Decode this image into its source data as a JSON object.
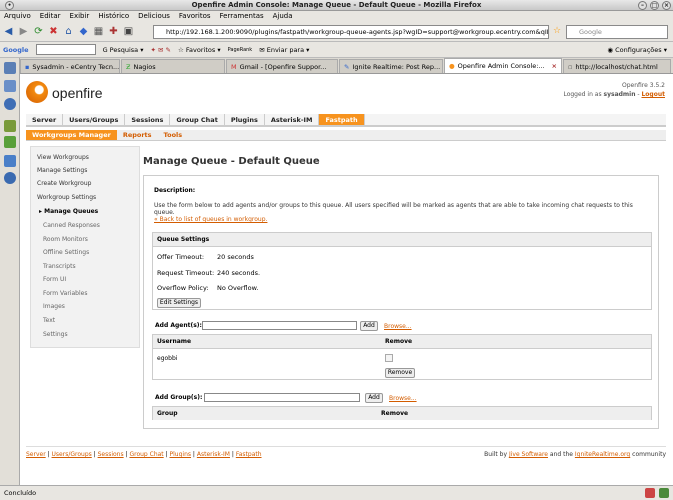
{
  "window": {
    "title": "Openfire Admin Console: Manage Queue - Default Queue - Mozilla Firefox"
  },
  "menu": [
    "Arquivo",
    "Editar",
    "Exibir",
    "Histórico",
    "Delicious",
    "Favoritos",
    "Ferramentas",
    "Ajuda"
  ],
  "address": {
    "url": "http://192.168.1.200:9090/plugins/fastpath/workgroup-queue-agents.jsp?wgID=support@workgroup.ecentry.com&qID"
  },
  "search": {
    "placeholder": "Google"
  },
  "googlebar": {
    "label": "Google",
    "pesquisa": "Pesquisa",
    "favoritos": "Favoritos",
    "pagerank": "PageRank",
    "enviar": "Enviar para",
    "config": "Configurações"
  },
  "tabs": [
    {
      "label": "Sysadmin - eCentry Tecn...",
      "active": false
    },
    {
      "label": "Nagios",
      "active": false
    },
    {
      "label": "Gmail - [Openfire Suppor...",
      "active": false
    },
    {
      "label": "Ignite Realtime: Post Rep...",
      "active": false
    },
    {
      "label": "Openfire Admin Console:...",
      "active": true
    },
    {
      "label": "http://localhost/chat.html",
      "active": false
    }
  ],
  "app": {
    "logo": "openfire",
    "version": "Openfire 3.5.2",
    "logged_prefix": "Logged in as",
    "user": "sysadmin",
    "logout": "Logout"
  },
  "mainnav": [
    "Server",
    "Users/Groups",
    "Sessions",
    "Group Chat",
    "Plugins",
    "Asterisk-IM",
    "Fastpath"
  ],
  "subnav": [
    "Workgroups Manager",
    "Reports",
    "Tools"
  ],
  "sidebar": {
    "items": [
      "View Workgroups",
      "Manage Settings",
      "Create Workgroup",
      "Workgroup Settings"
    ],
    "current": "Manage Queues",
    "subitems": [
      "Canned Responses",
      "Room Monitors",
      "Offline Settings",
      "Transcripts",
      "Form UI",
      "Form Variables",
      "Images",
      "Text",
      "Settings"
    ]
  },
  "page": {
    "title": "Manage Queue - Default Queue",
    "desc_heading": "Description:",
    "desc_text": "Use the form below to add agents and/or groups to this queue. All users specified will be marked as agents that are able to take incoming chat requests to this queue.",
    "back_link": "« Back to list of queues in workgroup.",
    "queue_settings": {
      "heading": "Queue Settings",
      "offer_label": "Offer Timeout:",
      "offer_value": "20 seconds",
      "request_label": "Request Timeout:",
      "request_value": "240 seconds.",
      "overflow_label": "Overflow Policy:",
      "overflow_value": "No Overflow.",
      "edit_button": "Edit Settings"
    },
    "agents": {
      "label": "Add Agent(s):",
      "add_button": "Add",
      "browse": "Browse...",
      "col_user": "Username",
      "col_remove": "Remove",
      "rows": [
        "egobbi"
      ],
      "remove_button": "Remove"
    },
    "groups": {
      "label": "Add Group(s):",
      "add_button": "Add",
      "browse": "Browse...",
      "col_group": "Group",
      "col_remove": "Remove"
    }
  },
  "footer": {
    "links": [
      "Server",
      "Users/Groups",
      "Sessions",
      "Group Chat",
      "Plugins",
      "Asterisk-IM",
      "Fastpath"
    ],
    "built_prefix": "Built by",
    "built_company": "Jive Software",
    "built_mid": "and the",
    "built_site": "IgniteRealtime.org",
    "built_suffix": "community"
  },
  "status": {
    "text": "Concluído"
  },
  "colors": {
    "accent": "#f7931e",
    "link": "#d35c00"
  }
}
